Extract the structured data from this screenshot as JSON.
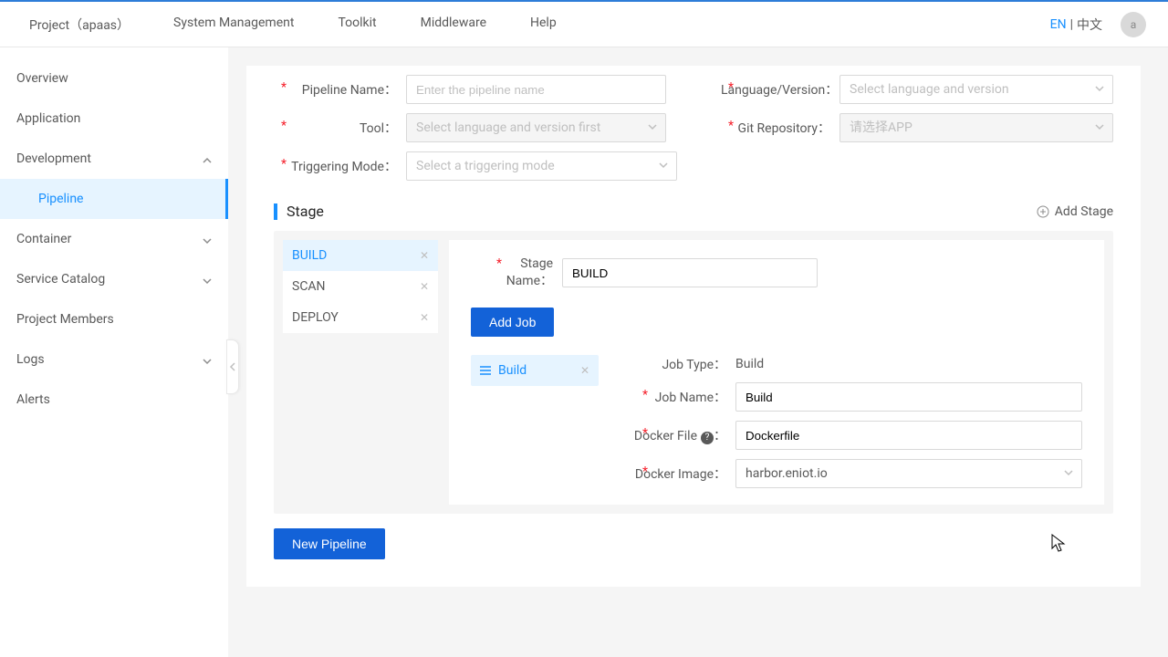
{
  "header": {
    "nav": [
      "Project（apaas）",
      "System Management",
      "Toolkit",
      "Middleware",
      "Help"
    ],
    "lang_en": "EN",
    "lang_sep": "|",
    "lang_zh": "中文",
    "avatar_letter": "a"
  },
  "sidebar": {
    "items": [
      {
        "label": "Overview",
        "expandable": false
      },
      {
        "label": "Application",
        "expandable": false
      },
      {
        "label": "Development",
        "expandable": true,
        "expanded": true
      },
      {
        "label": "Container",
        "expandable": true,
        "expanded": false
      },
      {
        "label": "Service Catalog",
        "expandable": true,
        "expanded": false
      },
      {
        "label": "Project Members",
        "expandable": false
      },
      {
        "label": "Logs",
        "expandable": true,
        "expanded": false
      },
      {
        "label": "Alerts",
        "expandable": false
      }
    ],
    "sub_pipeline": "Pipeline"
  },
  "form": {
    "pipeline_name_label": "Pipeline Name：",
    "pipeline_name_ph": "Enter the pipeline name",
    "lang_label": "Language/Version：",
    "lang_ph": "Select language and version",
    "tool_label": "Tool：",
    "tool_ph": "Select language and version first",
    "git_label": "Git Repository：",
    "git_ph": "请选择APP",
    "trigger_label": "Triggering Mode：",
    "trigger_ph": "Select a triggering mode"
  },
  "stage": {
    "title": "Stage",
    "add_stage": "Add  Stage",
    "tabs": [
      "BUILD",
      "SCAN",
      "DEPLOY"
    ],
    "stage_name_label": "Stage Name：",
    "stage_name_value": "BUILD",
    "add_job": "Add Job",
    "job_tab": "Build",
    "job_type_label": "Job Type：",
    "job_type_value": "Build",
    "job_name_label": "Job Name：",
    "job_name_value": "Build",
    "docker_file_label": "Docker File",
    "docker_file_value": "Dockerfile",
    "docker_image_label": "Docker Image：",
    "docker_image_value": "harbor.eniot.io"
  },
  "buttons": {
    "new_pipeline": "New Pipeline"
  }
}
